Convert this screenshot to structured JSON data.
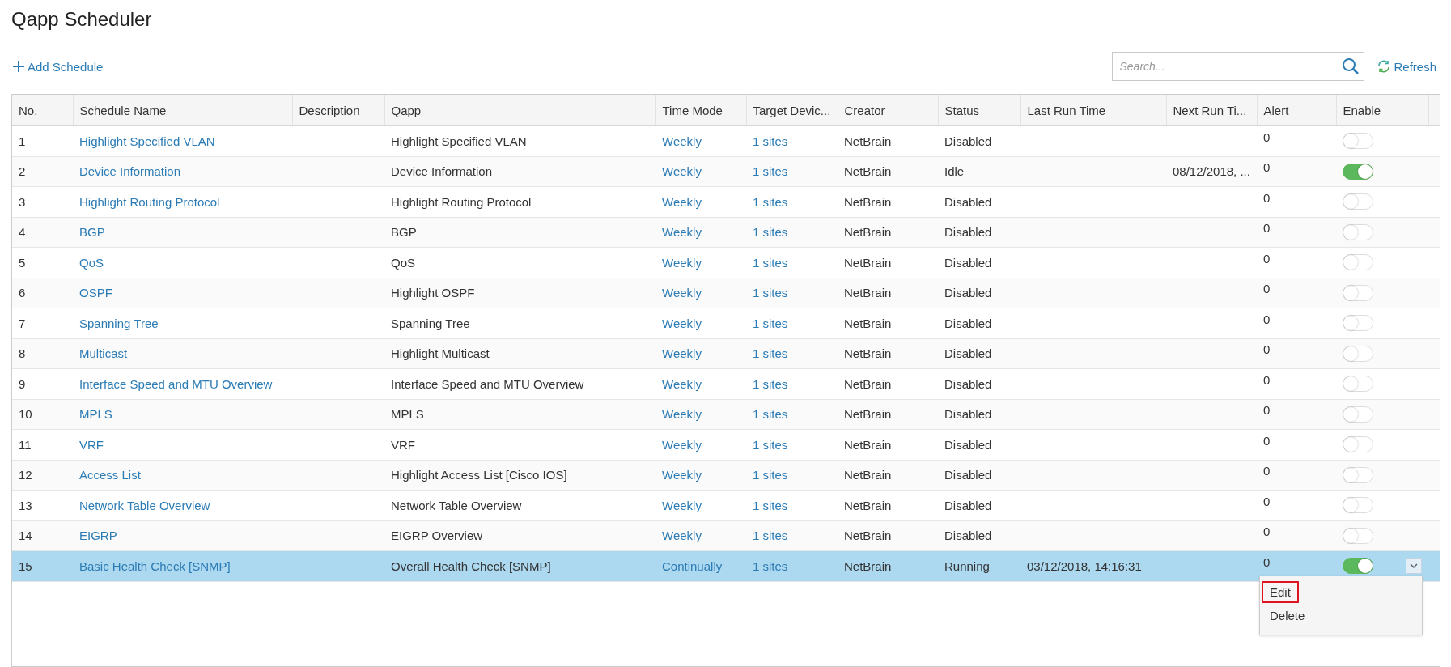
{
  "page": {
    "title": "Qapp Scheduler"
  },
  "toolbar": {
    "add_label": "Add Schedule",
    "search": {
      "placeholder": "Search..."
    },
    "refresh_label": "Refresh"
  },
  "table": {
    "columns": [
      "No.",
      "Schedule Name",
      "Description",
      "Qapp",
      "Time Mode",
      "Target Devic...",
      "Creator",
      "Status",
      "Last Run Time",
      "Next Run Ti...",
      "Alert",
      "Enable"
    ],
    "rows": [
      {
        "no": "1",
        "name": "Highlight Specified VLAN",
        "qapp": "Highlight Specified VLAN",
        "time_mode": "Weekly",
        "target": "1 sites",
        "creator": "NetBrain",
        "status": "Disabled",
        "alert": "0",
        "enabled": false,
        "selected": false
      },
      {
        "no": "2",
        "name": "Device Information",
        "qapp": "Device Information",
        "time_mode": "Weekly",
        "target": "1 sites",
        "creator": "NetBrain",
        "status": "Idle",
        "next_run": "08/12/2018, ...",
        "alert": "0",
        "enabled": true,
        "selected": false
      },
      {
        "no": "3",
        "name": "Highlight Routing Protocol",
        "qapp": "Highlight Routing Protocol",
        "time_mode": "Weekly",
        "target": "1 sites",
        "creator": "NetBrain",
        "status": "Disabled",
        "alert": "0",
        "enabled": false,
        "selected": false
      },
      {
        "no": "4",
        "name": "BGP",
        "qapp": "BGP",
        "time_mode": "Weekly",
        "target": "1 sites",
        "creator": "NetBrain",
        "status": "Disabled",
        "alert": "0",
        "enabled": false,
        "selected": false
      },
      {
        "no": "5",
        "name": "QoS",
        "qapp": "QoS",
        "time_mode": "Weekly",
        "target": "1 sites",
        "creator": "NetBrain",
        "status": "Disabled",
        "alert": "0",
        "enabled": false,
        "selected": false
      },
      {
        "no": "6",
        "name": "OSPF",
        "qapp": "Highlight OSPF",
        "time_mode": "Weekly",
        "target": "1 sites",
        "creator": "NetBrain",
        "status": "Disabled",
        "alert": "0",
        "enabled": false,
        "selected": false
      },
      {
        "no": "7",
        "name": "Spanning Tree",
        "qapp": "Spanning Tree",
        "time_mode": "Weekly",
        "target": "1 sites",
        "creator": "NetBrain",
        "status": "Disabled",
        "alert": "0",
        "enabled": false,
        "selected": false
      },
      {
        "no": "8",
        "name": "Multicast",
        "qapp": "Highlight Multicast",
        "time_mode": "Weekly",
        "target": "1 sites",
        "creator": "NetBrain",
        "status": "Disabled",
        "alert": "0",
        "enabled": false,
        "selected": false
      },
      {
        "no": "9",
        "name": "Interface Speed and MTU Overview",
        "qapp": "Interface Speed and MTU Overview",
        "time_mode": "Weekly",
        "target": "1 sites",
        "creator": "NetBrain",
        "status": "Disabled",
        "alert": "0",
        "enabled": false,
        "selected": false
      },
      {
        "no": "10",
        "name": "MPLS",
        "qapp": "MPLS",
        "time_mode": "Weekly",
        "target": "1 sites",
        "creator": "NetBrain",
        "status": "Disabled",
        "alert": "0",
        "enabled": false,
        "selected": false
      },
      {
        "no": "11",
        "name": "VRF",
        "qapp": "VRF",
        "time_mode": "Weekly",
        "target": "1 sites",
        "creator": "NetBrain",
        "status": "Disabled",
        "alert": "0",
        "enabled": false,
        "selected": false
      },
      {
        "no": "12",
        "name": "Access List",
        "qapp": "Highlight Access List [Cisco IOS]",
        "time_mode": "Weekly",
        "target": "1 sites",
        "creator": "NetBrain",
        "status": "Disabled",
        "alert": "0",
        "enabled": false,
        "selected": false
      },
      {
        "no": "13",
        "name": "Network Table Overview",
        "qapp": "Network Table Overview",
        "time_mode": "Weekly",
        "target": "1 sites",
        "creator": "NetBrain",
        "status": "Disabled",
        "alert": "0",
        "enabled": false,
        "selected": false
      },
      {
        "no": "14",
        "name": "EIGRP",
        "qapp": "EIGRP Overview",
        "time_mode": "Weekly",
        "target": "1 sites",
        "creator": "NetBrain",
        "status": "Disabled",
        "alert": "0",
        "enabled": false,
        "selected": false
      },
      {
        "no": "15",
        "name": "Basic Health Check [SNMP]",
        "qapp": "Overall Health Check [SNMP]",
        "time_mode": "Continually",
        "target": "1 sites",
        "creator": "NetBrain",
        "status": "Running",
        "last_run": "03/12/2018, 14:16:31",
        "alert": "0",
        "enabled": true,
        "selected": true
      }
    ]
  },
  "row_menu": {
    "items": [
      {
        "label": "Edit",
        "highlighted": true
      },
      {
        "label": "Delete",
        "highlighted": false
      }
    ]
  }
}
